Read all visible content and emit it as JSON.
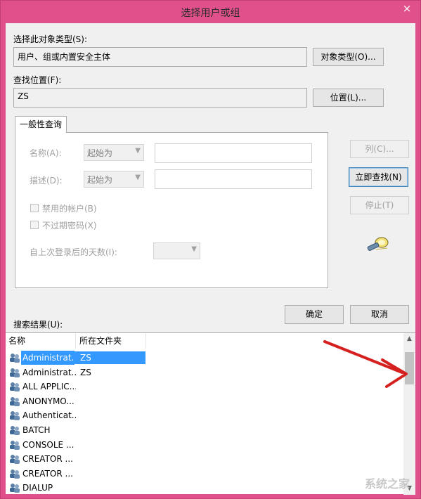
{
  "window": {
    "title": "选择用户或组",
    "close": "×"
  },
  "object_type": {
    "label": "选择此对象类型(S):",
    "value": "用户、组或内置安全主体",
    "button": "对象类型(O)..."
  },
  "location": {
    "label": "查找位置(F):",
    "value": "ZS",
    "button": "位置(L)..."
  },
  "general_query": {
    "tab": "一般性查询",
    "name_label": "名称(A):",
    "name_match": "起始为",
    "desc_label": "描述(D):",
    "desc_match": "起始为",
    "disabled_accounts": "禁用的帐户(B)",
    "non_expiring_pw": "不过期密码(X)",
    "days_since_login": "自上次登录后的天数(I):"
  },
  "side_buttons": {
    "columns": "列(C)...",
    "find_now": "立即查找(N)",
    "stop": "停止(T)"
  },
  "dialog_buttons": {
    "ok": "确定",
    "cancel": "取消"
  },
  "results": {
    "label": "搜索结果(U):",
    "columns": [
      "名称",
      "所在文件夹"
    ],
    "rows": [
      {
        "name": "Administrat...",
        "folder": "ZS",
        "selected": true
      },
      {
        "name": "Administrat...",
        "folder": "ZS",
        "selected": false
      },
      {
        "name": "ALL APPLIC...",
        "folder": "",
        "selected": false
      },
      {
        "name": "ANONYMO...",
        "folder": "",
        "selected": false
      },
      {
        "name": "Authenticat...",
        "folder": "",
        "selected": false
      },
      {
        "name": "BATCH",
        "folder": "",
        "selected": false
      },
      {
        "name": "CONSOLE ...",
        "folder": "",
        "selected": false
      },
      {
        "name": "CREATOR ...",
        "folder": "",
        "selected": false
      },
      {
        "name": "CREATOR ...",
        "folder": "",
        "selected": false
      },
      {
        "name": "DIALUP",
        "folder": "",
        "selected": false
      }
    ]
  },
  "icons": {
    "user": "user-group-icon",
    "search": "search-flashlight-icon"
  },
  "colors": {
    "frame": "#e0518c",
    "selection": "#3399ff",
    "annotation_arrow": "#d62020"
  },
  "watermark": "系统之家"
}
